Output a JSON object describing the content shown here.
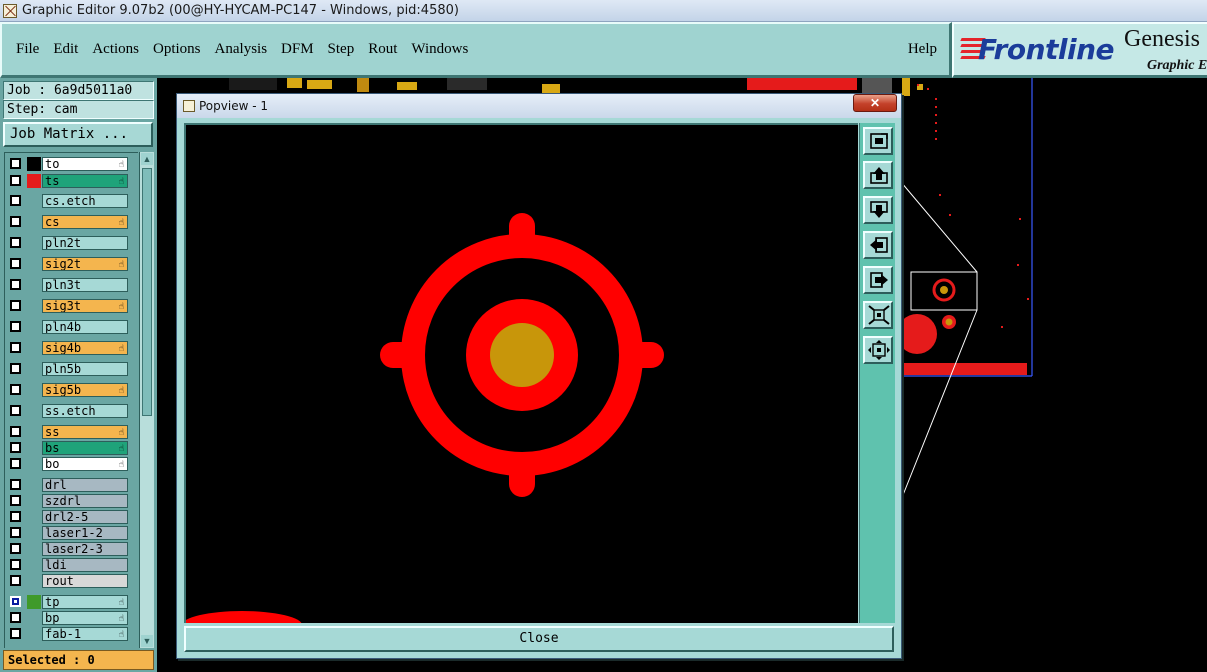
{
  "window": {
    "title": "Graphic Editor 9.07b2 (00@HY-HYCAM-PC147 - Windows, pid:4580)"
  },
  "menubar": {
    "items": [
      "File",
      "Edit",
      "Actions",
      "Options",
      "Analysis",
      "DFM",
      "Step",
      "Rout",
      "Windows"
    ],
    "help": "Help"
  },
  "logo": {
    "brand": "Frontline",
    "product": "Genesis",
    "subtitle": "Graphic E"
  },
  "left": {
    "job": "Job : 6a9d5011a0",
    "step": "Step: cam",
    "job_matrix": "Job Matrix ...",
    "selected": "Selected : 0"
  },
  "layers": [
    {
      "name": "to",
      "color": "#ffffff",
      "swatch": "#000000",
      "hand": true,
      "checked": false
    },
    {
      "name": "ts",
      "color": "#1fa37a",
      "swatch": "#e51b1b",
      "hand": true,
      "checked": false
    },
    {
      "name": "cs.etch",
      "color": "#a6d9d6",
      "swatch": "",
      "hand": false,
      "checked": false
    },
    {
      "name": "cs",
      "color": "#f4b54e",
      "swatch": "",
      "hand": true,
      "checked": false
    },
    {
      "name": "pln2t",
      "color": "#a6d9d6",
      "swatch": "",
      "hand": false,
      "checked": false
    },
    {
      "name": "sig2t",
      "color": "#f4b54e",
      "swatch": "",
      "hand": true,
      "checked": false
    },
    {
      "name": "pln3t",
      "color": "#a6d9d6",
      "swatch": "",
      "hand": false,
      "checked": false
    },
    {
      "name": "sig3t",
      "color": "#f4b54e",
      "swatch": "",
      "hand": true,
      "checked": false
    },
    {
      "name": "pln4b",
      "color": "#a6d9d6",
      "swatch": "",
      "hand": false,
      "checked": false
    },
    {
      "name": "sig4b",
      "color": "#f4b54e",
      "swatch": "",
      "hand": true,
      "checked": false
    },
    {
      "name": "pln5b",
      "color": "#a6d9d6",
      "swatch": "",
      "hand": false,
      "checked": false
    },
    {
      "name": "sig5b",
      "color": "#f4b54e",
      "swatch": "",
      "hand": true,
      "checked": false
    },
    {
      "name": "ss.etch",
      "color": "#a6d9d6",
      "swatch": "",
      "hand": false,
      "checked": false
    },
    {
      "name": "ss",
      "color": "#f4b54e",
      "swatch": "",
      "hand": true,
      "checked": false
    },
    {
      "name": "bs",
      "color": "#1fa37a",
      "swatch": "",
      "hand": true,
      "checked": false
    },
    {
      "name": "bo",
      "color": "#ffffff",
      "swatch": "",
      "hand": true,
      "checked": false
    },
    {
      "name": "drl",
      "color": "#a7b8c2",
      "swatch": "",
      "hand": false,
      "checked": false
    },
    {
      "name": "szdrl",
      "color": "#a7b8c2",
      "swatch": "",
      "hand": false,
      "checked": false
    },
    {
      "name": "drl2-5",
      "color": "#a7b8c2",
      "swatch": "",
      "hand": false,
      "checked": false
    },
    {
      "name": "laser1-2",
      "color": "#a7b8c2",
      "swatch": "",
      "hand": false,
      "checked": false
    },
    {
      "name": "laser2-3",
      "color": "#a7b8c2",
      "swatch": "",
      "hand": false,
      "checked": false
    },
    {
      "name": "ldi",
      "color": "#a7b8c2",
      "swatch": "",
      "hand": false,
      "checked": false
    },
    {
      "name": "rout",
      "color": "#d8d8d8",
      "swatch": "",
      "hand": false,
      "checked": false
    },
    {
      "name": "tp",
      "color": "#a6d9d6",
      "swatch": "#3f9a2a",
      "hand": true,
      "checked": true
    },
    {
      "name": "bp",
      "color": "#a6d9d6",
      "swatch": "",
      "hand": true,
      "checked": false
    },
    {
      "name": "fab-1",
      "color": "#a6d9d6",
      "swatch": "",
      "hand": true,
      "checked": false
    }
  ],
  "popview": {
    "title": "Popview - 1",
    "close_x": "✕",
    "close_label": "Close",
    "tools": [
      "zoom-fit-icon",
      "pan-up-icon",
      "pan-down-icon",
      "pan-left-icon",
      "pan-right-icon",
      "zoom-out-icon",
      "zoom-in-icon"
    ]
  },
  "colors": {
    "pad_red": "#ff0000",
    "pad_gold": "#c8960a",
    "panel": "#6aa6a3"
  }
}
